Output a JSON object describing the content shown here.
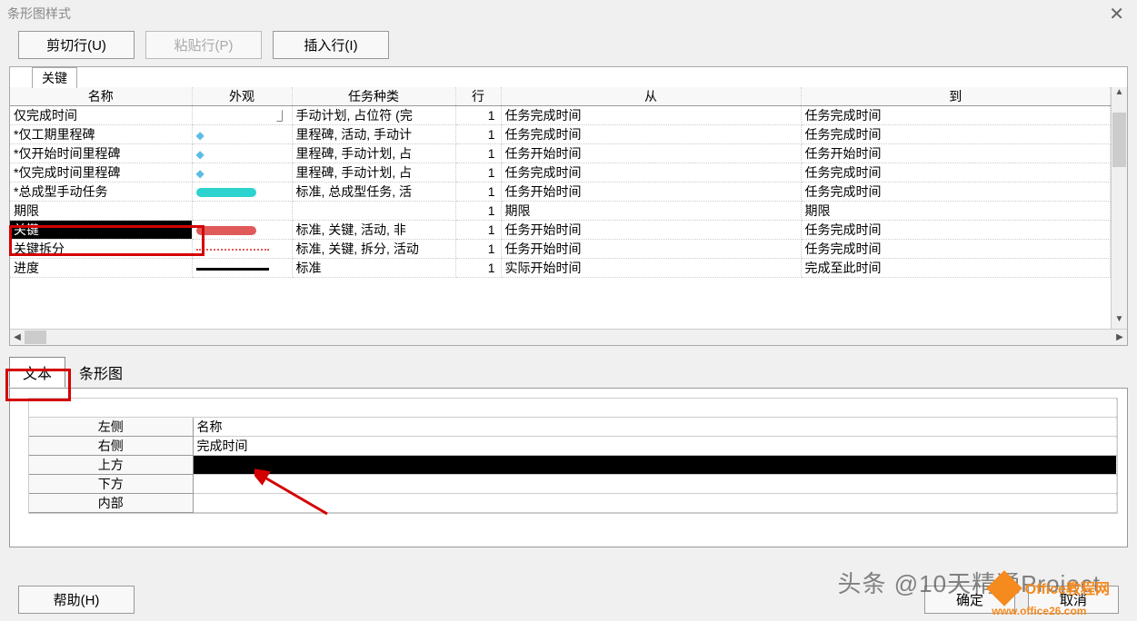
{
  "window": {
    "title": "条形图样式"
  },
  "toolbar": {
    "cut_row": "剪切行(U)",
    "paste_row": "粘贴行(P)",
    "insert_row": "插入行(I)"
  },
  "top_tab": {
    "label": "关键"
  },
  "columns": {
    "name": "名称",
    "appearance": "外观",
    "task_type": "任务种类",
    "row": "行",
    "from": "从",
    "to": "到"
  },
  "rows": [
    {
      "name": "仅完成时间",
      "appearance": "mark",
      "type": "手动计划, 占位符 (完",
      "row": "1",
      "from": "任务完成时间",
      "to": "任务完成时间"
    },
    {
      "name": "*仅工期里程碑",
      "appearance": "diamond",
      "type": "里程碑, 活动, 手动计",
      "row": "1",
      "from": "任务完成时间",
      "to": "任务完成时间"
    },
    {
      "name": "*仅开始时间里程碑",
      "appearance": "diamond",
      "type": "里程碑, 手动计划, 占",
      "row": "1",
      "from": "任务开始时间",
      "to": "任务开始时间"
    },
    {
      "name": "*仅完成时间里程碑",
      "appearance": "diamond",
      "type": "里程碑, 手动计划, 占",
      "row": "1",
      "from": "任务完成时间",
      "to": "任务完成时间"
    },
    {
      "name": "*总成型手动任务",
      "appearance": "cyan-bar",
      "type": "标准, 总成型任务, 活",
      "row": "1",
      "from": "任务开始时间",
      "to": "任务完成时间"
    },
    {
      "name": "期限",
      "appearance": "",
      "type": "",
      "row": "1",
      "from": "期限",
      "to": "期限"
    },
    {
      "name": "关键",
      "appearance": "red-bar",
      "type": "标准, 关键, 活动, 非",
      "row": "1",
      "from": "任务开始时间",
      "to": "任务完成时间",
      "selected": true
    },
    {
      "name": "关键拆分",
      "appearance": "red-dots",
      "type": "标准, 关键, 拆分, 活动",
      "row": "1",
      "from": "任务开始时间",
      "to": "任务完成时间"
    },
    {
      "name": "进度",
      "appearance": "black-bar",
      "type": "标准",
      "row": "1",
      "from": "实际开始时间",
      "to": "完成至此时间"
    }
  ],
  "tabs": {
    "text": "文本",
    "bar": "条形图"
  },
  "text_fields": {
    "left": {
      "label": "左侧",
      "value": "名称"
    },
    "right": {
      "label": "右侧",
      "value": "完成时间"
    },
    "top": {
      "label": "上方",
      "value": "",
      "selected": true
    },
    "bottom": {
      "label": "下方",
      "value": ""
    },
    "inside": {
      "label": "内部",
      "value": ""
    }
  },
  "footer": {
    "help": "帮助(H)",
    "ok": "确定",
    "cancel": "取消"
  },
  "watermark": {
    "line1": "头条 @10天精通Project",
    "line2_a": "Office教程网",
    "line2_b": "www.office26.com"
  }
}
